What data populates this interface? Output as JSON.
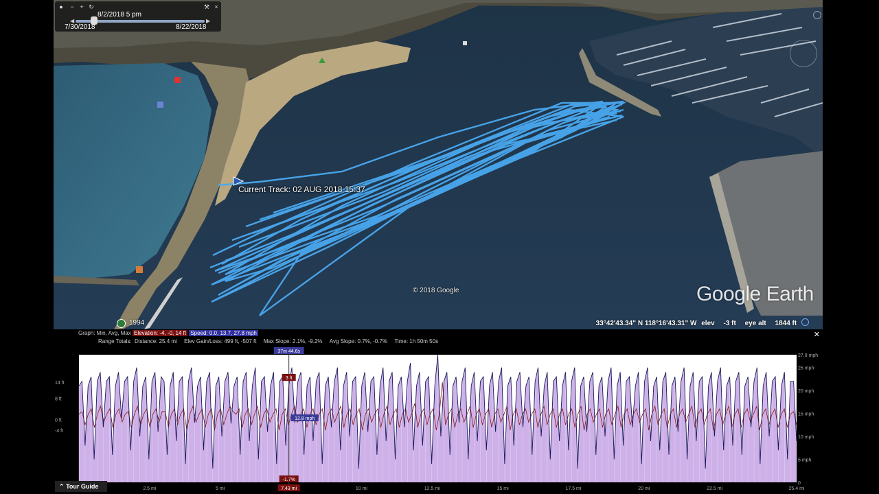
{
  "time_slider": {
    "current": "8/2/2018   5 pm",
    "start": "7/30/2018",
    "end": "8/22/2018"
  },
  "map": {
    "track_label": "Current Track: 02 AUG 2018 15:37",
    "copyright": "© 2018 Google",
    "logo": "Google Earth",
    "imagery_year": "1994",
    "track_color": "#4aa8f0"
  },
  "status": {
    "lat": "33°42'43.34\" N",
    "lon": "118°16'43.31\" W",
    "elev_label": "elev",
    "elev_value": "-3 ft",
    "eye_label": "eye alt",
    "eye_value": "1844 ft"
  },
  "profile": {
    "graph_label": "Graph: Min, Avg, Max",
    "elevation_stats": "Elevation: -4, -0, 14 ft",
    "speed_stats": "Speed: 0.0, 13.7, 27.8 mph",
    "range_label": "Range Totals:",
    "distance": "Distance: 25.4 mi",
    "elev_gain": "Elev Gain/Loss: 499 ft, -507 ft",
    "max_slope": "Max Slope: 2.1%, -9.2%",
    "avg_slope": "Avg Slope: 0.7%, -0.7%",
    "time": "Time: 1h 50m 50s",
    "cursor_time": "37m 44.6s",
    "cursor_elev": "3 ft",
    "cursor_speed": "12.8 mph",
    "cursor_slope": "-1.7%",
    "cursor_dist": "7.43 mi",
    "tour_guide": "Tour Guide"
  },
  "chart_data": {
    "type": "line",
    "x_unit": "mi",
    "xlim": [
      0,
      25.4
    ],
    "x_ticks": [
      "2.5 mi",
      "5 mi",
      "10 mi",
      "12.5 mi",
      "15 mi",
      "17.5 mi",
      "20 mi",
      "22.5 mi",
      "25.4 mi"
    ],
    "x_tick_values": [
      2.5,
      5,
      10,
      12.5,
      15,
      17.5,
      20,
      22.5,
      25.4
    ],
    "left_axis_labels": [
      "14 ft",
      "8 ft",
      "0 ft",
      "-4 ft"
    ],
    "right_axis_labels": [
      "27.8 mph",
      "25 mph",
      "20 mph",
      "15 mph",
      "10 mph",
      "5 mph",
      "0"
    ],
    "right_axis_values": [
      27.8,
      25,
      20,
      15,
      10,
      5,
      0
    ],
    "ylim_speed": [
      0,
      27.8
    ],
    "cursor_x": 7.43,
    "series": [
      {
        "name": "Speed",
        "color": "#1a1a5a",
        "values": [
          21,
          22,
          8,
          21,
          23,
          5,
          22,
          24,
          12,
          22,
          23,
          6,
          21,
          24,
          14,
          22,
          23,
          7,
          22,
          25,
          10,
          21,
          23,
          5,
          22,
          24,
          11,
          23,
          22,
          6,
          21,
          24,
          9,
          22,
          23,
          4,
          22,
          25,
          13,
          21,
          23,
          7,
          22,
          24,
          3,
          21,
          23,
          10,
          22,
          24,
          12.8,
          21,
          23,
          6,
          22,
          24,
          9,
          21,
          25,
          5,
          22,
          23,
          11,
          21,
          24,
          4,
          22,
          23,
          8,
          21,
          25,
          13,
          22,
          24,
          6,
          21,
          23,
          9,
          22,
          24,
          4,
          21,
          23,
          12,
          22,
          25,
          7,
          21,
          24,
          10,
          22,
          23,
          3,
          21,
          24,
          11,
          22,
          23,
          6,
          21,
          25,
          9,
          22,
          24,
          5,
          21,
          23,
          12,
          22,
          26,
          7,
          21,
          24,
          8,
          22,
          23,
          4,
          21,
          27.8,
          10,
          22,
          24,
          6,
          21,
          23,
          13,
          22,
          25,
          5,
          21,
          24,
          9,
          22,
          23,
          7,
          21,
          24,
          11,
          22,
          25,
          4,
          21,
          23,
          8,
          22,
          24,
          12,
          21,
          23,
          6,
          22,
          25,
          10,
          21,
          24,
          5,
          22,
          23,
          9,
          21,
          24,
          7,
          22,
          25,
          3,
          21,
          23,
          11,
          22,
          24,
          6,
          21,
          23,
          10,
          22,
          25,
          5,
          21,
          24,
          8,
          22,
          23,
          12,
          21,
          24,
          4,
          22,
          25,
          9,
          21,
          23,
          7,
          22,
          24,
          6,
          21,
          23,
          11,
          22,
          25,
          5,
          21,
          24,
          9,
          22,
          23,
          3,
          21,
          24,
          10,
          22,
          25,
          7,
          21,
          23,
          8,
          22,
          24,
          6,
          21,
          23,
          12,
          22,
          25,
          4,
          21,
          24,
          10,
          22,
          23,
          7,
          21,
          24,
          5,
          22,
          22,
          9
        ]
      },
      {
        "name": "Elevation",
        "color": "#8a1a1a",
        "values": [
          2,
          3,
          -2,
          2,
          4,
          -3,
          2,
          5,
          -1,
          2,
          4,
          -3,
          2,
          4,
          -1,
          2,
          3,
          -3,
          2,
          5,
          -2,
          2,
          4,
          -3,
          2,
          4,
          -1,
          3,
          3,
          -3,
          2,
          4,
          -2,
          2,
          4,
          -4,
          2,
          5,
          -1,
          2,
          4,
          -3,
          2,
          4,
          -4,
          2,
          4,
          -2,
          2,
          5,
          3,
          2,
          4,
          -3,
          2,
          4,
          -2,
          2,
          5,
          -3,
          2,
          4,
          -1,
          2,
          4,
          -4,
          2,
          4,
          -2,
          2,
          5,
          -1,
          2,
          4,
          -3,
          2,
          4,
          -2,
          2,
          4,
          -4,
          2,
          4,
          -1,
          2,
          5,
          -3,
          2,
          4,
          -2,
          2,
          4,
          -4,
          2,
          4,
          -1,
          2,
          4,
          -3,
          2,
          5,
          -2,
          2,
          4,
          -3,
          2,
          4,
          -1,
          2,
          6,
          -3,
          2,
          4,
          -2,
          2,
          4,
          -4,
          2,
          14,
          -2,
          2,
          4,
          -3,
          2,
          4,
          -1,
          2,
          5,
          -3,
          2,
          4,
          -2,
          2,
          4,
          -3,
          2,
          4,
          -1,
          2,
          5,
          -4,
          2,
          4,
          -2,
          2,
          4,
          -1,
          2,
          4,
          -3,
          2,
          5,
          -2,
          2,
          4,
          -3,
          2,
          4,
          -2,
          2,
          4,
          -3,
          2,
          5,
          -4,
          2,
          4,
          -1,
          2,
          4,
          -3,
          2,
          4,
          -2,
          2,
          5,
          -3,
          2,
          4,
          -2,
          2,
          4,
          -1,
          2,
          4,
          -4,
          2,
          5,
          -2,
          2,
          4,
          -3,
          2,
          4,
          -3,
          2,
          4,
          -1,
          2,
          5,
          -3,
          2,
          4,
          -2,
          2,
          4,
          -4,
          2,
          4,
          -2,
          2,
          5,
          -3,
          2,
          4,
          -3,
          2,
          4,
          -1,
          2,
          5,
          -4,
          2,
          4,
          -2,
          2,
          4,
          -3,
          2,
          4,
          -3,
          2,
          3,
          -2
        ]
      }
    ]
  }
}
